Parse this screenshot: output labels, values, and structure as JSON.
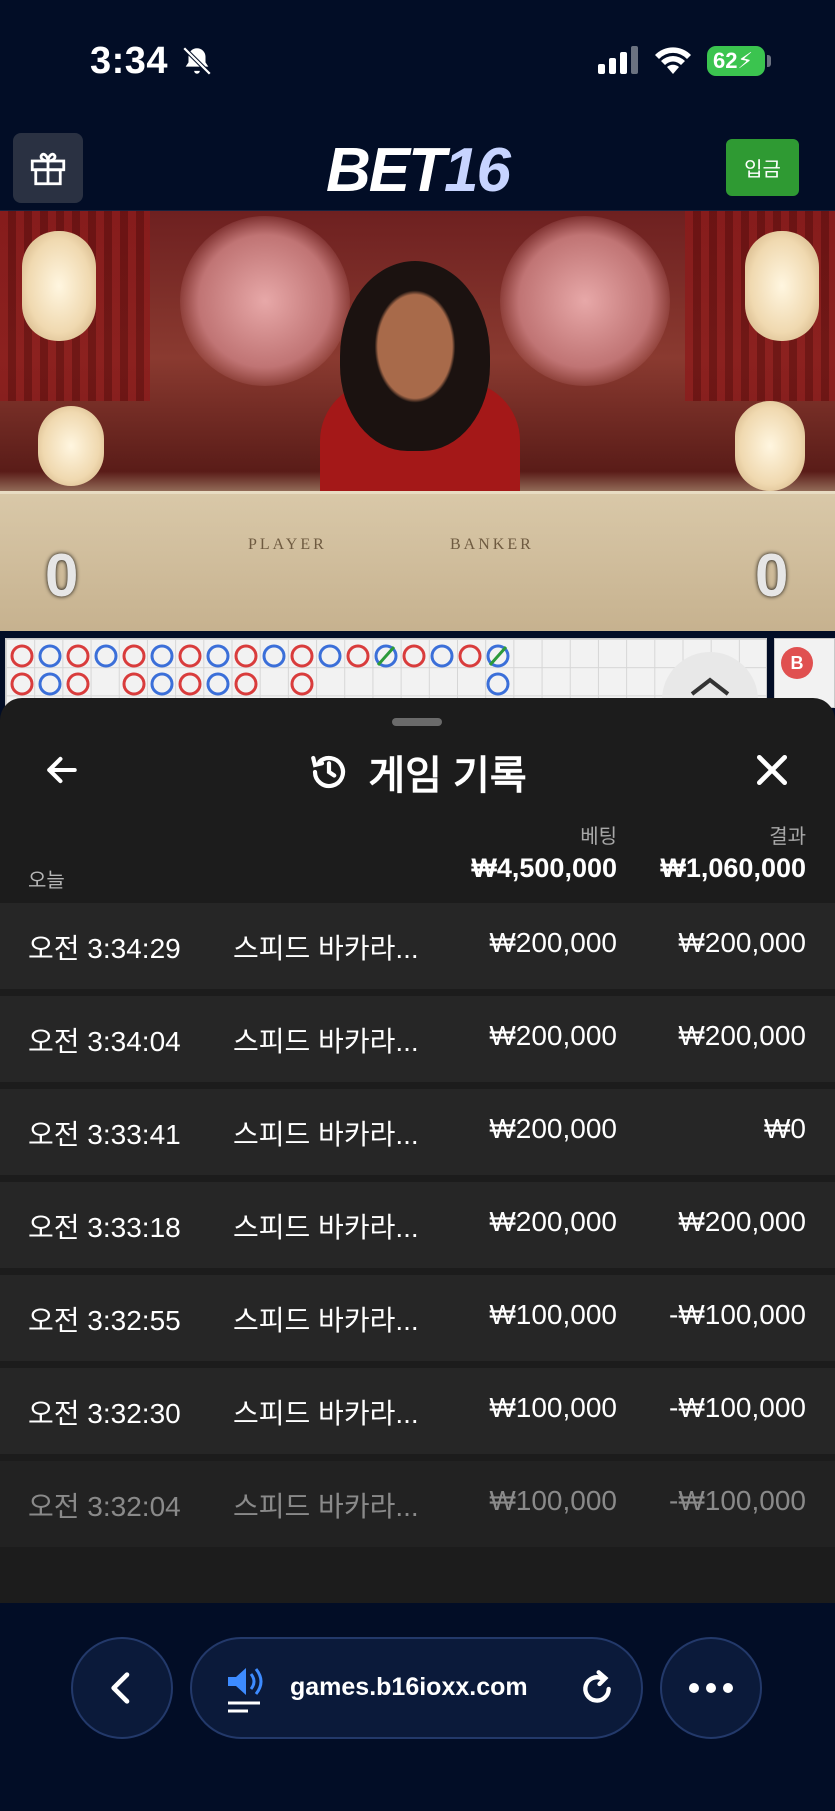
{
  "status_bar": {
    "time": "3:34",
    "battery": "62"
  },
  "header": {
    "logo_prefix": "BET",
    "logo_number": "16",
    "deposit_label": "입금"
  },
  "video": {
    "table_left": "PLAYER",
    "table_right": "BANKER",
    "player_score": "0",
    "banker_score": "0"
  },
  "roadmap": {
    "badge": "B"
  },
  "history": {
    "title": "게임 기록",
    "col_bet": "베팅",
    "col_result": "결과",
    "today_label": "오늘",
    "total_bet": "₩4,500,000",
    "total_result": "₩1,060,000",
    "rows": [
      {
        "time": "오전 3:34:29",
        "game": "스피드 바카라...",
        "bet": "₩200,000",
        "result": "₩200,000"
      },
      {
        "time": "오전 3:34:04",
        "game": "스피드 바카라...",
        "bet": "₩200,000",
        "result": "₩200,000"
      },
      {
        "time": "오전 3:33:41",
        "game": "스피드 바카라...",
        "bet": "₩200,000",
        "result": "₩0"
      },
      {
        "time": "오전 3:33:18",
        "game": "스피드 바카라...",
        "bet": "₩200,000",
        "result": "₩200,000"
      },
      {
        "time": "오전 3:32:55",
        "game": "스피드 바카라...",
        "bet": "₩100,000",
        "result": "-₩100,000"
      },
      {
        "time": "오전 3:32:30",
        "game": "스피드 바카라...",
        "bet": "₩100,000",
        "result": "-₩100,000"
      },
      {
        "time": "오전 3:32:04",
        "game": "스피드 바카라...",
        "bet": "₩100,000",
        "result": "-₩100,000"
      }
    ]
  },
  "browser": {
    "url": "games.b16ioxx.com"
  },
  "icons": [
    "bell-slash-icon",
    "signal-icon",
    "wifi-icon",
    "gift-icon",
    "arrow-left-icon",
    "history-icon",
    "close-icon",
    "chevron-left-icon",
    "speaker-icon",
    "reload-icon",
    "more-icon",
    "chevron-up-icon"
  ]
}
